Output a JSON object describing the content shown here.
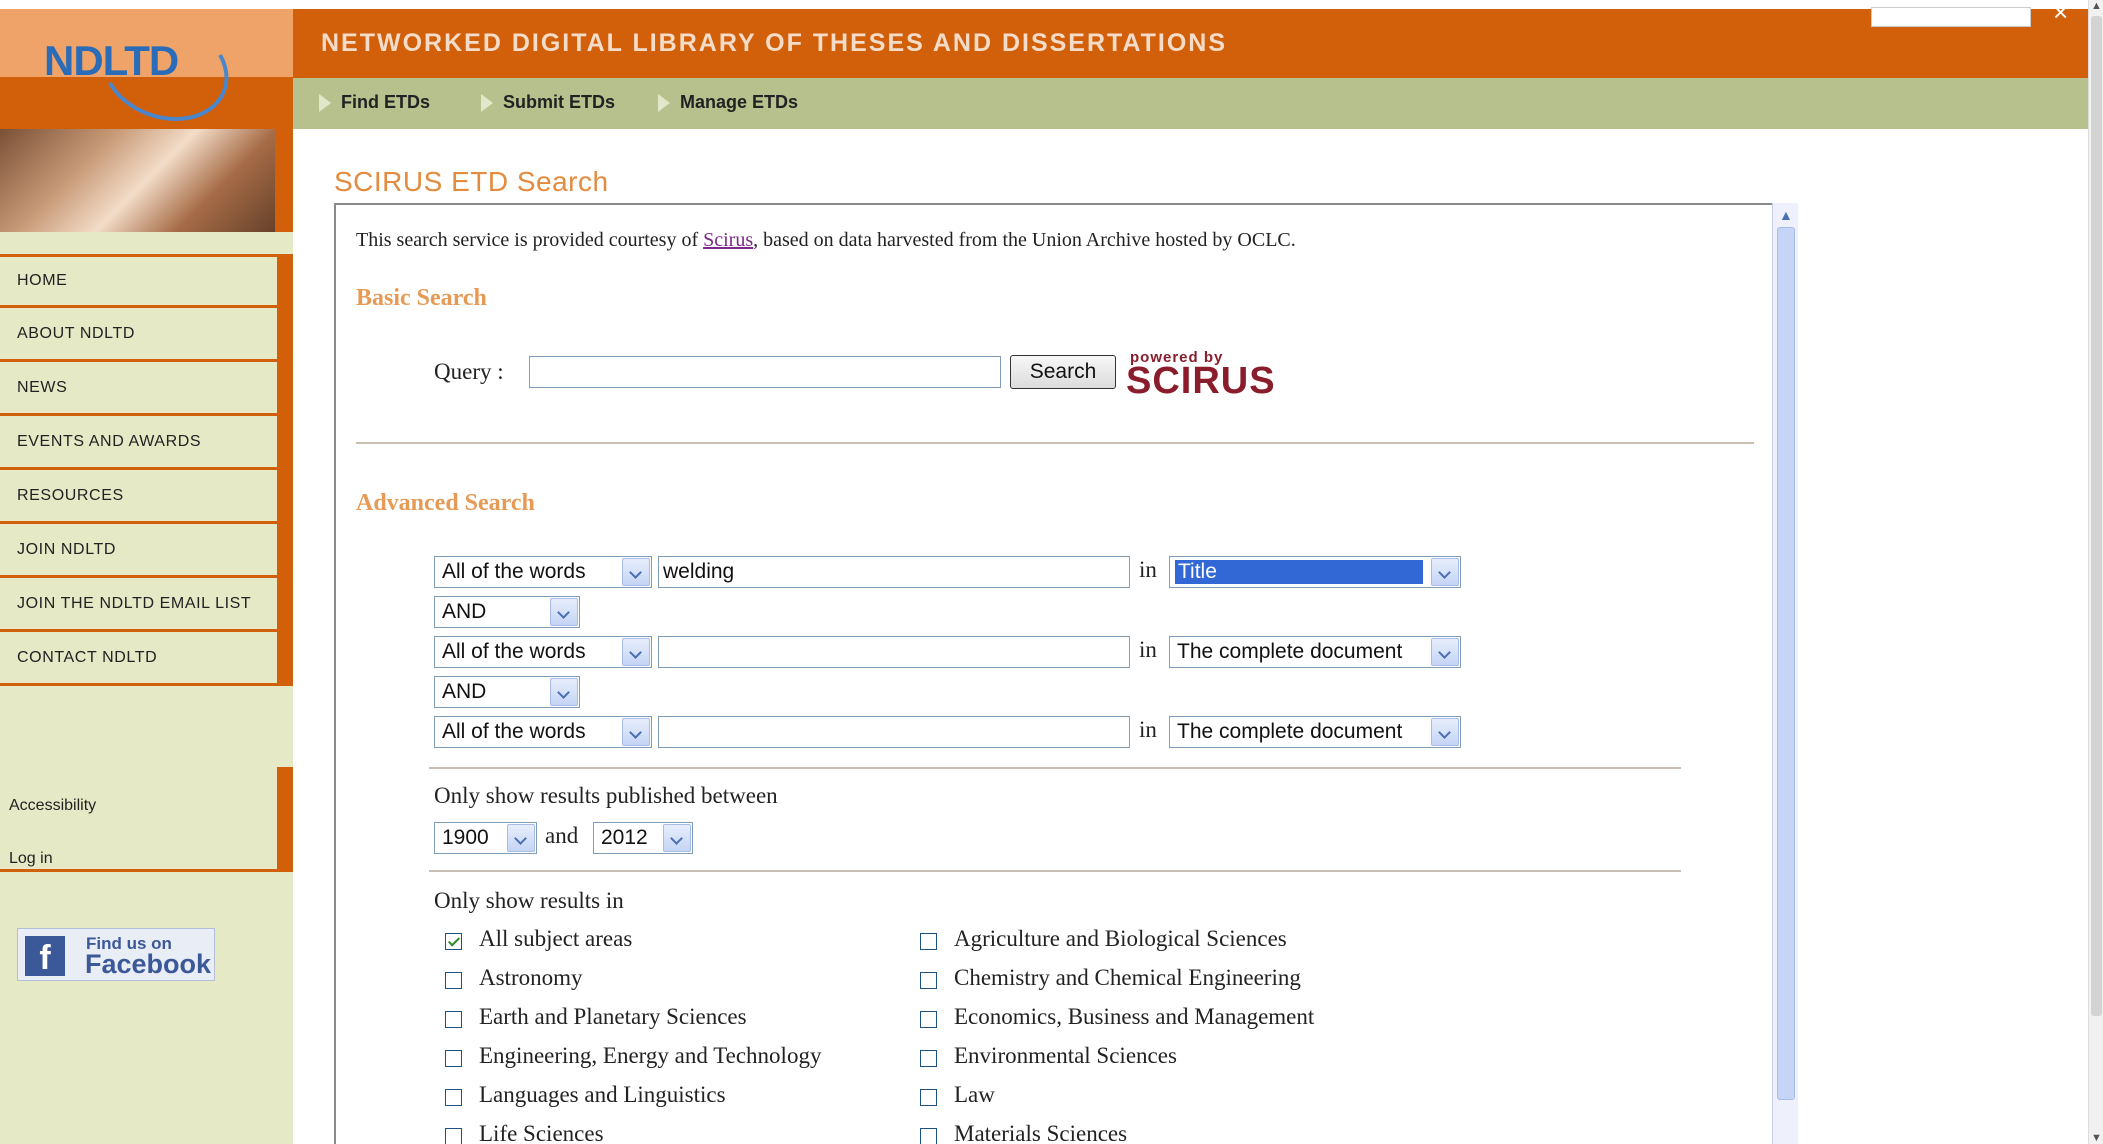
{
  "header": {
    "logo": "NDLTD",
    "site_title": "NETWORKED DIGITAL LIBRARY OF THESES AND DISSERTATIONS",
    "subnav": [
      "Find ETDs",
      "Submit ETDs",
      "Manage ETDs"
    ]
  },
  "sidebar": {
    "nav": [
      "HOME",
      "ABOUT NDLTD",
      "NEWS",
      "EVENTS AND AWARDS",
      "RESOURCES",
      "JOIN NDLTD",
      "JOIN THE NDLTD EMAIL LIST",
      "CONTACT NDLTD"
    ],
    "util": [
      "Accessibility",
      "Log in"
    ],
    "facebook": {
      "small": "Find us on",
      "big": "Facebook",
      "letter": "f"
    }
  },
  "main": {
    "page_title": "SCIRUS ETD Search",
    "intro": {
      "before": "This search service is provided courtesy of ",
      "link": "Scirus",
      "after": ", based on data harvested from the Union Archive hosted by OCLC."
    },
    "basic": {
      "heading": "Basic Search",
      "query_label": "Query :",
      "query_value": "",
      "button": "Search",
      "powered_by": "powered by",
      "scirus": "SCIRUS"
    },
    "advanced": {
      "heading": "Advanced Search",
      "rows": [
        {
          "mode": "All of the words",
          "term": "welding",
          "in": "in",
          "field": "Title"
        },
        {
          "mode": "All of the words",
          "term": "",
          "in": "in",
          "field": "The complete document"
        },
        {
          "mode": "All of the words",
          "term": "",
          "in": "in",
          "field": "The complete document"
        }
      ],
      "operators": [
        "AND",
        "AND"
      ],
      "date_label": "Only show results published between",
      "date_from": "1900",
      "date_and": "and",
      "date_to": "2012",
      "subject_label": "Only show results in",
      "subjects_left": [
        {
          "label": "All subject areas",
          "checked": true
        },
        {
          "label": "Astronomy",
          "checked": false
        },
        {
          "label": "Earth and Planetary Sciences",
          "checked": false
        },
        {
          "label": "Engineering, Energy and Technology",
          "checked": false
        },
        {
          "label": "Languages and Linguistics",
          "checked": false
        },
        {
          "label": "Life Sciences",
          "checked": false
        }
      ],
      "subjects_right": [
        {
          "label": "Agriculture and Biological Sciences",
          "checked": false
        },
        {
          "label": "Chemistry and Chemical Engineering",
          "checked": false
        },
        {
          "label": "Economics, Business and Management",
          "checked": false
        },
        {
          "label": "Environmental Sciences",
          "checked": false
        },
        {
          "label": "Law",
          "checked": false
        },
        {
          "label": "Materials Sciences",
          "checked": false
        }
      ]
    }
  },
  "colors": {
    "brand_orange": "#d2600a",
    "header_light": "#f0a368",
    "subnav_green": "#b7c18d",
    "sidebar_bg": "#e5e9c6",
    "heading_orange": "#e79a55",
    "selection_blue": "#3168d5"
  }
}
